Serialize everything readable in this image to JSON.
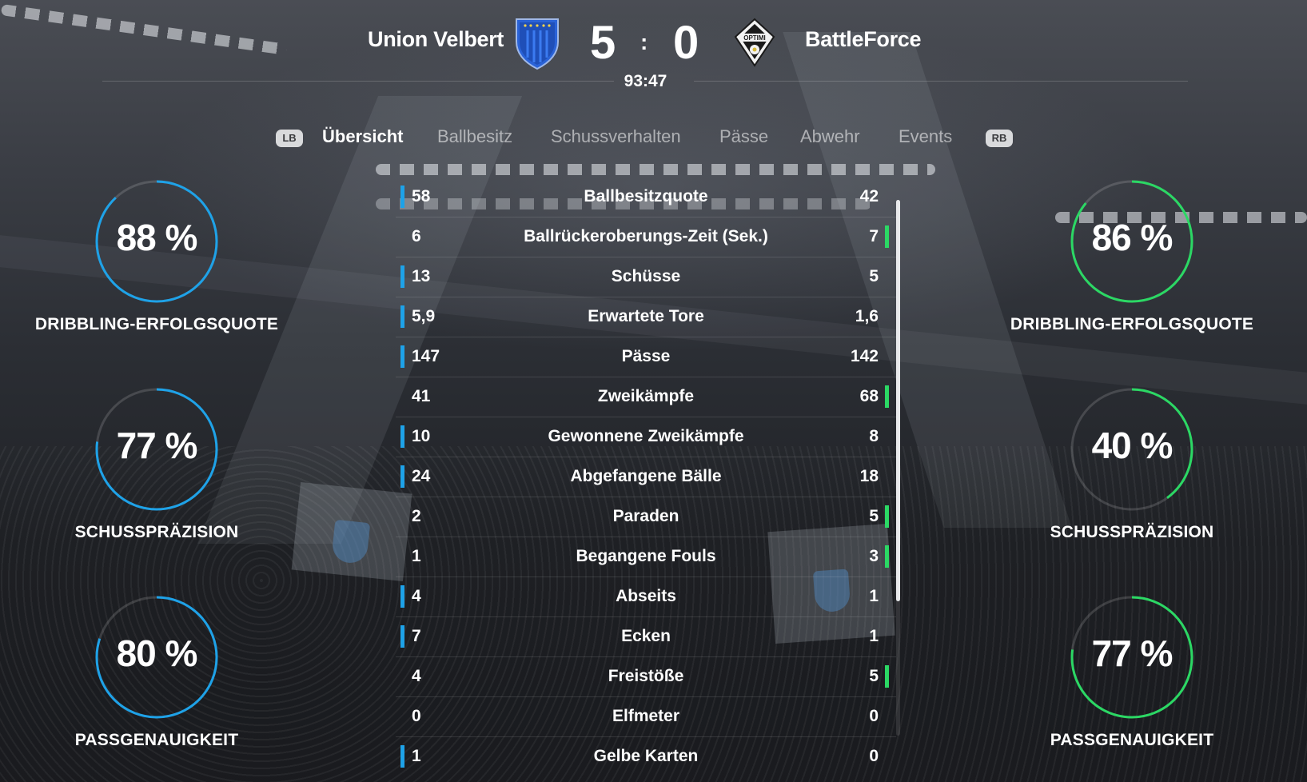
{
  "match": {
    "home": {
      "name": "Union Velbert",
      "score": "5",
      "crest_icon": "blue-shield-crest-icon",
      "color": "#1ea2e8"
    },
    "away": {
      "name": "BattleForce",
      "score": "0",
      "crest_icon": "optimi-shield-crest-icon",
      "crest_text": "OPTIMI",
      "color": "#2bd864"
    },
    "separator": ":",
    "clock": "93:47"
  },
  "tabs": {
    "left_hint": "LB",
    "right_hint": "RB",
    "items": [
      {
        "label": "Übersicht",
        "active": true
      },
      {
        "label": "Ballbesitz",
        "active": false
      },
      {
        "label": "Schussverhalten",
        "active": false
      },
      {
        "label": "Pässe",
        "active": false
      },
      {
        "label": "Abwehr",
        "active": false
      },
      {
        "label": "Events",
        "active": false
      }
    ]
  },
  "home_rings": [
    {
      "value": "88 %",
      "label": "DRIBBLING-ERFOLGSQUOTE",
      "fraction": 0.88
    },
    {
      "value": "77 %",
      "label": "SCHUSSPRÄZISION",
      "fraction": 0.77
    },
    {
      "value": "80 %",
      "label": "PASSGENAUIGKEIT",
      "fraction": 0.8
    }
  ],
  "away_rings": [
    {
      "value": "86 %",
      "label": "DRIBBLING-ERFOLGSQUOTE",
      "fraction": 0.86
    },
    {
      "value": "40 %",
      "label": "SCHUSSPRÄZISION",
      "fraction": 0.4
    },
    {
      "value": "77 %",
      "label": "PASSGENAUIGKEIT",
      "fraction": 0.77
    }
  ],
  "stats": [
    {
      "name": "Ballbesitzquote",
      "home": "58",
      "away": "42",
      "leader": "home"
    },
    {
      "name": "Ballrückeroberungs-Zeit (Sek.)",
      "home": "6",
      "away": "7",
      "leader": "away"
    },
    {
      "name": "Schüsse",
      "home": "13",
      "away": "5",
      "leader": "home"
    },
    {
      "name": "Erwartete Tore",
      "home": "5,9",
      "away": "1,6",
      "leader": "home"
    },
    {
      "name": "Pässe",
      "home": "147",
      "away": "142",
      "leader": "home"
    },
    {
      "name": "Zweikämpfe",
      "home": "41",
      "away": "68",
      "leader": "away"
    },
    {
      "name": "Gewonnene Zweikämpfe",
      "home": "10",
      "away": "8",
      "leader": "home"
    },
    {
      "name": "Abgefangene Bälle",
      "home": "24",
      "away": "18",
      "leader": "home"
    },
    {
      "name": "Paraden",
      "home": "2",
      "away": "5",
      "leader": "away"
    },
    {
      "name": "Begangene Fouls",
      "home": "1",
      "away": "3",
      "leader": "away"
    },
    {
      "name": "Abseits",
      "home": "4",
      "away": "1",
      "leader": "home"
    },
    {
      "name": "Ecken",
      "home": "7",
      "away": "1",
      "leader": "home"
    },
    {
      "name": "Freistöße",
      "home": "4",
      "away": "5",
      "leader": "away"
    },
    {
      "name": "Elfmeter",
      "home": "0",
      "away": "0",
      "leader": "none"
    },
    {
      "name": "Gelbe Karten",
      "home": "1",
      "away": "0",
      "leader": "home"
    }
  ]
}
